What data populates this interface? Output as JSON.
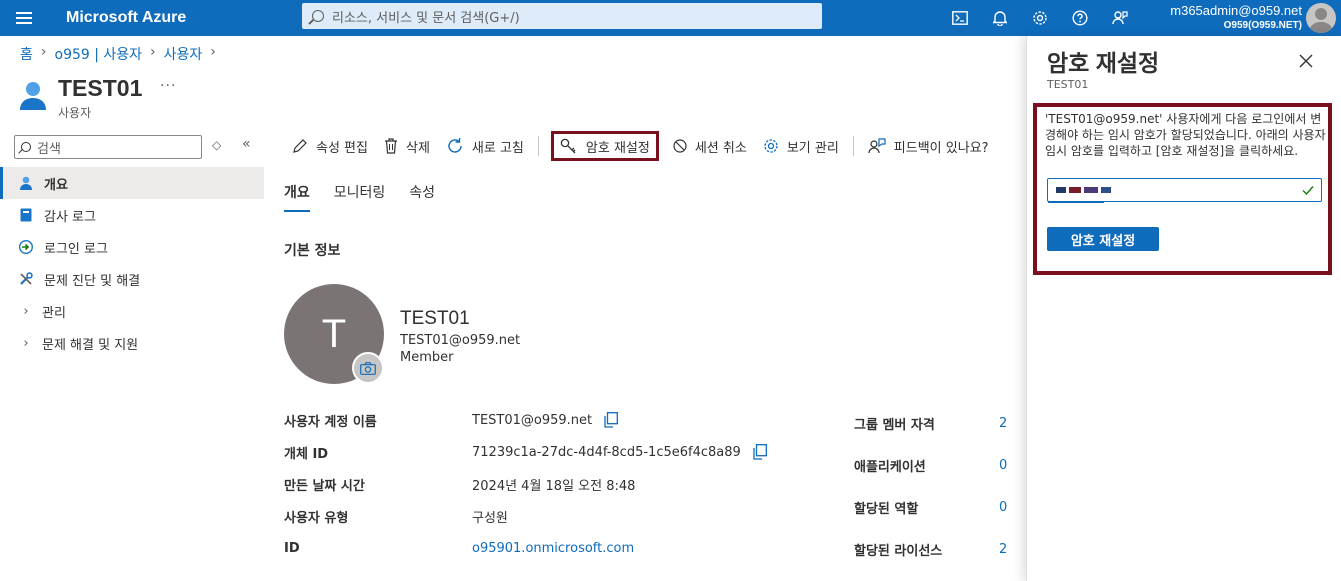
{
  "topbar": {
    "brand": "Microsoft Azure",
    "search_placeholder": "리소스, 서비스 및 문서 검색(G+/)",
    "account_user": "m365admin@o959.net",
    "account_org": "O959(O959.NET)",
    "icons": [
      "cloud-shell-icon",
      "bell-icon",
      "gear-icon",
      "help-icon",
      "feedback-icon"
    ]
  },
  "breadcrumb": [
    "홈",
    "o959 | 사용자",
    "사용자"
  ],
  "header": {
    "title": "TEST01",
    "subtitle": "사용자",
    "more": "···"
  },
  "nav": {
    "search_placeholder": "검색",
    "items": [
      {
        "label": "개요",
        "icon": "user-icon",
        "active": true
      },
      {
        "label": "감사 로그",
        "icon": "book-icon"
      },
      {
        "label": "로그인 로그",
        "icon": "signin-icon"
      },
      {
        "label": "문제 진단 및 해결",
        "icon": "wrench-icon"
      },
      {
        "label": "관리",
        "icon": "chevron-right-icon"
      },
      {
        "label": "문제 해결 및 지원",
        "icon": "chevron-right-icon"
      }
    ]
  },
  "toolbar": {
    "edit": "속성 편집",
    "delete": "삭제",
    "refresh": "새로 고침",
    "reset_password": "암호 재설정",
    "revoke": "세션 취소",
    "manage_view": "보기 관리",
    "feedback": "피드백이 있나요?"
  },
  "tabs": [
    "개요",
    "모니터링",
    "속성"
  ],
  "section_title": "기본 정보",
  "profile": {
    "initial": "T",
    "name": "TEST01",
    "email": "TEST01@o959.net",
    "type": "Member"
  },
  "properties": [
    {
      "label": "사용자 계정 이름",
      "value": "TEST01@o959.net",
      "copy": true
    },
    {
      "label": "개체 ID",
      "value": "71239c1a-27dc-4d4f-8cd5-1c5e6f4c8a89",
      "copy": true
    },
    {
      "label": "만든 날짜 시간",
      "value": "2024년 4월 18일 오전 8:48"
    },
    {
      "label": "사용자 유형",
      "value": "구성원"
    },
    {
      "label": "ID",
      "value": "o95901.onmicrosoft.com",
      "link": true
    }
  ],
  "stats": [
    {
      "label": "그룹 멤버 자격",
      "value": "2"
    },
    {
      "label": "애플리케이션",
      "value": "0"
    },
    {
      "label": "할당된 역할",
      "value": "0"
    },
    {
      "label": "할당된 라이선스",
      "value": "2"
    }
  ],
  "panel": {
    "title": "암호 재설정",
    "subtitle": "TEST01",
    "message": "'TEST01@o959.net' 사용자에게 다음 로그인에서 변경해야 하는 임시 암호가 할당되었습니다. 아래의 사용자 임시 암호를 입력하고 [암호 재설정]을 클릭하세요.",
    "button": "암호 재설정"
  },
  "colors": {
    "accent": "#0f6cbd",
    "highlight": "#7a0f1e"
  }
}
